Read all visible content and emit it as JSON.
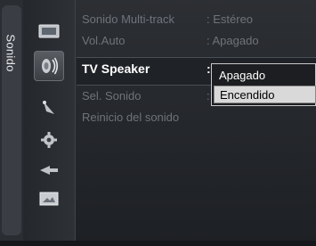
{
  "category": "Sonido",
  "menu": [
    {
      "label": "Sonido Multi-track",
      "value": ": Estéreo"
    },
    {
      "label": "Vol.Auto",
      "value": ": Apagado"
    },
    {
      "label": "TV Speaker",
      "value": ":"
    },
    {
      "label": "Sel. Sonido",
      "value": ":"
    },
    {
      "label": "Reinicio del sonido",
      "value": ""
    }
  ],
  "popup_options": [
    "Apagado",
    "Encendido"
  ],
  "icons": [
    "picture-icon",
    "sound-icon",
    "channel-icon",
    "setup-icon",
    "input-icon",
    "application-icon"
  ]
}
